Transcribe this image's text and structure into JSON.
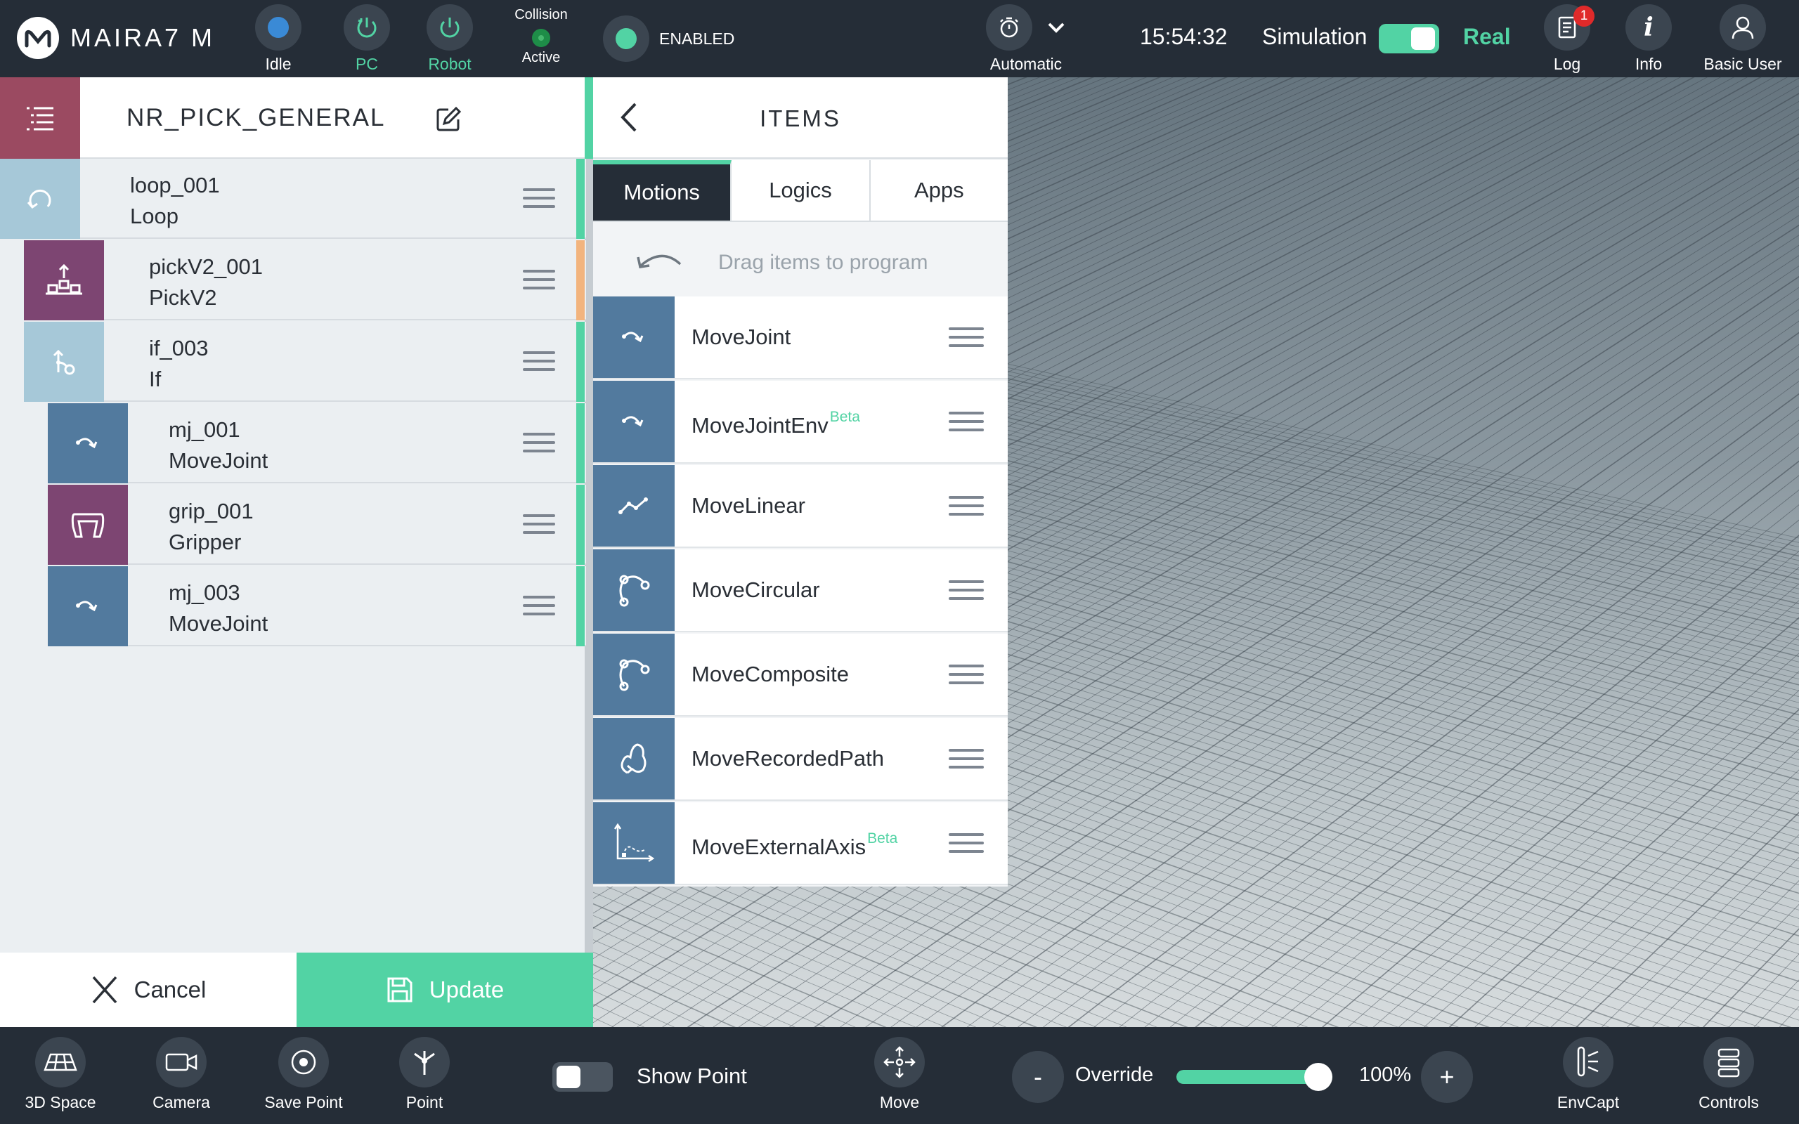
{
  "topbar": {
    "brand": "MAIRA7 M",
    "status_idle": "Idle",
    "status_pc": "PC",
    "status_robot": "Robot",
    "collision_title": "Collision",
    "collision_state": "Active",
    "enabled_label": "ENABLED",
    "mode_label": "Automatic",
    "time": "15:54:32",
    "simulation_label": "Simulation",
    "real_label": "Real",
    "log_label": "Log",
    "log_badge": "1",
    "info_label": "Info",
    "user_label": "Basic User",
    "accent_color": "#52d3a4"
  },
  "program": {
    "title": "NR_PICK_GENERAL",
    "rows": [
      {
        "name": "loop_001",
        "type": "Loop",
        "icon": "loop-icon",
        "color": "#a6c8d8"
      },
      {
        "name": "pickV2_001",
        "type": "PickV2",
        "icon": "pick-icon",
        "color": "#7d4572"
      },
      {
        "name": "if_003",
        "type": "If",
        "icon": "if-branch-icon",
        "color": "#a6c8d8"
      },
      {
        "name": "mj_001",
        "type": "MoveJoint",
        "icon": "move-joint-icon",
        "color": "#527a9e"
      },
      {
        "name": "grip_001",
        "type": "Gripper",
        "icon": "gripper-icon",
        "color": "#7d4572"
      },
      {
        "name": "mj_003",
        "type": "MoveJoint",
        "icon": "move-joint-icon",
        "color": "#527a9e"
      }
    ],
    "cancel_label": "Cancel",
    "update_label": "Update"
  },
  "items": {
    "title": "ITEMS",
    "tabs": [
      "Motions",
      "Logics",
      "Apps"
    ],
    "active_tab": "Motions",
    "drag_hint": "Drag items to program",
    "list": [
      {
        "label": "MoveJoint",
        "beta": "",
        "icon": "move-joint-icon"
      },
      {
        "label": "MoveJointEnv",
        "beta": "Beta",
        "icon": "move-joint-env-icon"
      },
      {
        "label": "MoveLinear",
        "beta": "",
        "icon": "move-linear-icon"
      },
      {
        "label": "MoveCircular",
        "beta": "",
        "icon": "move-circular-icon"
      },
      {
        "label": "MoveComposite",
        "beta": "",
        "icon": "move-composite-icon"
      },
      {
        "label": "MoveRecordedPath",
        "beta": "",
        "icon": "move-recorded-path-icon"
      },
      {
        "label": "MoveExternalAxis",
        "beta": "Beta",
        "icon": "move-external-axis-icon"
      }
    ]
  },
  "bottombar": {
    "space_label": "3D Space",
    "camera_label": "Camera",
    "save_point_label": "Save Point",
    "point_label": "Point",
    "show_point_label": "Show Point",
    "move_label": "Move",
    "override_label": "Override",
    "override_minus": "-",
    "override_plus": "+",
    "override_value": "100%",
    "override_fraction": 1.0,
    "envcapt_label": "EnvCapt",
    "controls_label": "Controls"
  }
}
